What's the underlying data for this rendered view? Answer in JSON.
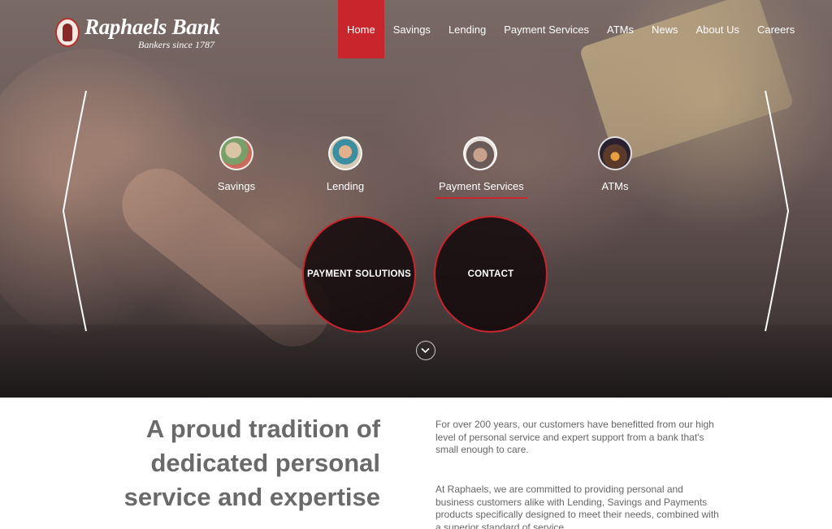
{
  "brand": {
    "name": "Raphaels Bank",
    "tagline": "Bankers since 1787",
    "accent_color": "#c8262c"
  },
  "nav": {
    "items": [
      {
        "label": "Home",
        "active": true
      },
      {
        "label": "Savings",
        "active": false
      },
      {
        "label": "Lending",
        "active": false
      },
      {
        "label": "Payment Services",
        "active": false
      },
      {
        "label": "ATMs",
        "active": false
      },
      {
        "label": "News",
        "active": false
      },
      {
        "label": "About Us",
        "active": false
      },
      {
        "label": "Careers",
        "active": false
      }
    ]
  },
  "hero": {
    "categories": [
      {
        "label": "Savings",
        "icon": "savings-icon",
        "active": false
      },
      {
        "label": "Lending",
        "icon": "lending-icon",
        "active": false
      },
      {
        "label": "Payment Services",
        "icon": "payment-services-icon",
        "active": true
      },
      {
        "label": "ATMs",
        "icon": "atms-icon",
        "active": false
      }
    ],
    "actions": [
      {
        "label": "PAYMENT SOLUTIONS"
      },
      {
        "label": "CONTACT"
      }
    ],
    "left_arrow_icon": "chevron-left-icon",
    "right_arrow_icon": "chevron-right-icon",
    "scroll_icon": "chevron-down-icon"
  },
  "intro": {
    "heading_lines": [
      "A proud tradition of",
      "dedicated personal",
      "service and expertise"
    ],
    "paragraphs": [
      "For over 200 years, our customers have benefitted from our high level of personal service and expert support from a bank that's small enough to care.",
      "At Raphaels, we are committed to providing personal and business customers alike with Lending, Savings and Payments products specifically designed to meet their needs, combined with a superior standard of service."
    ]
  }
}
